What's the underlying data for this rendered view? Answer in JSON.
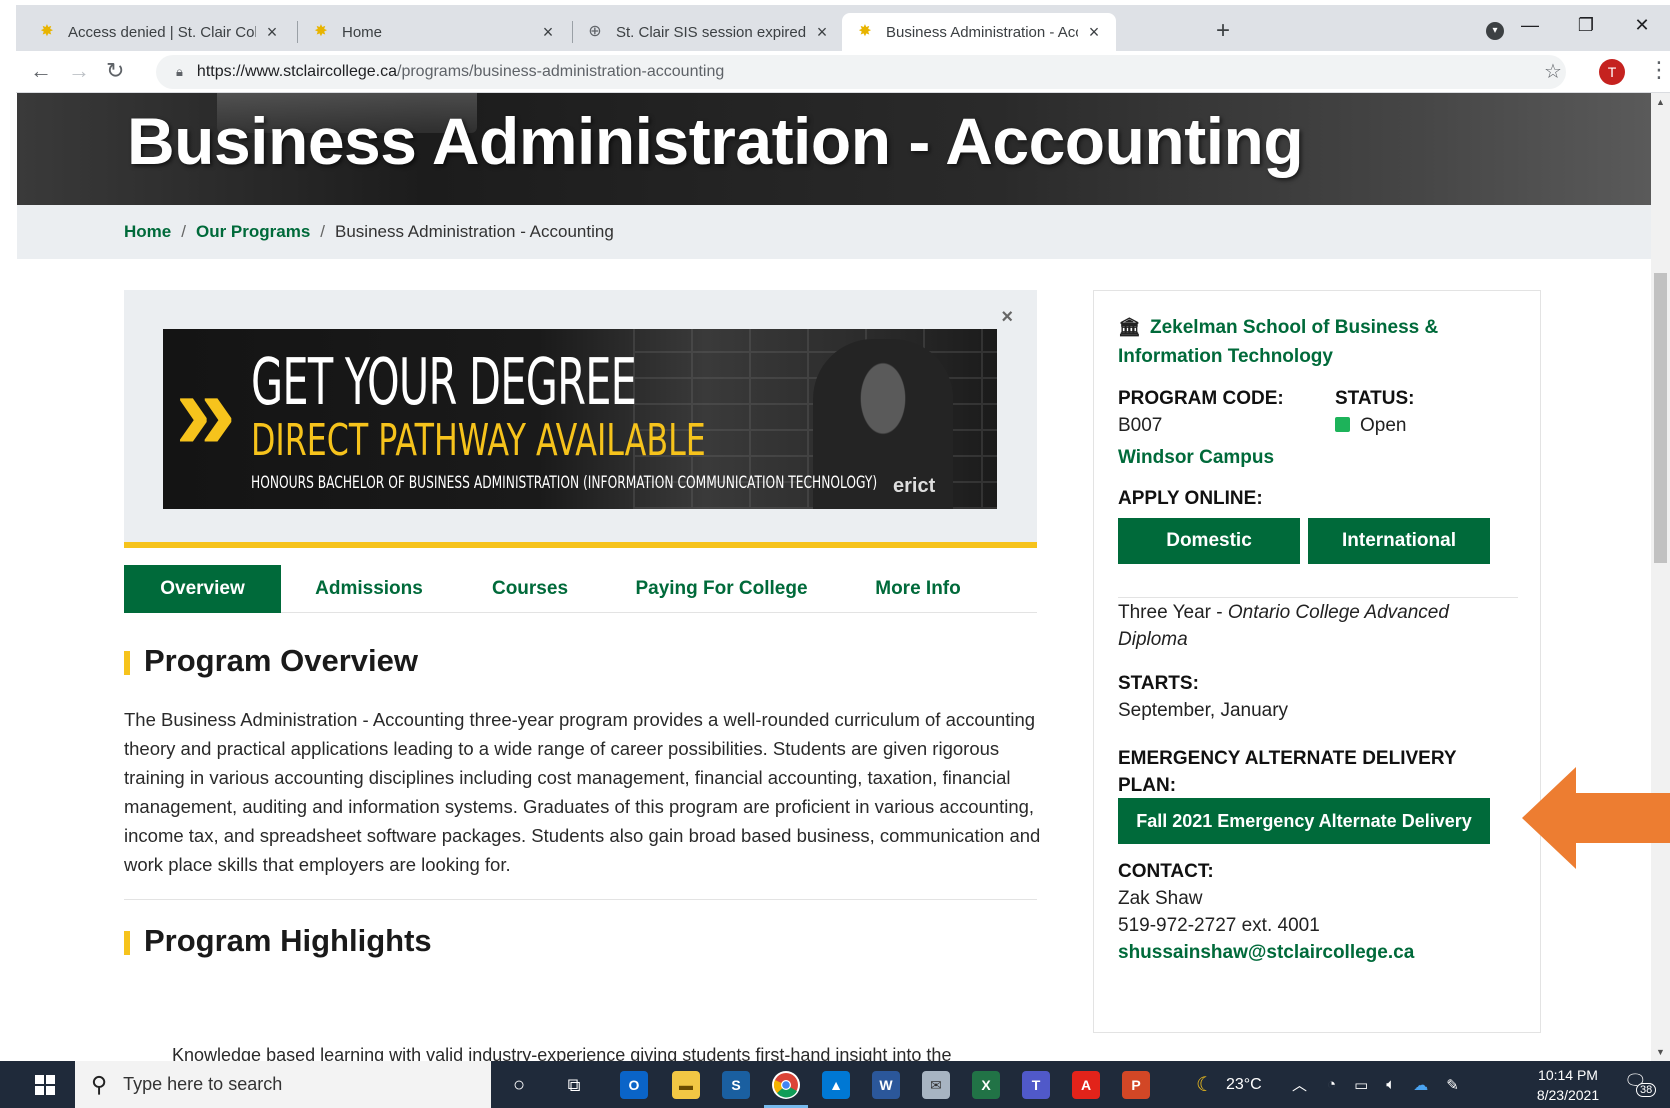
{
  "browser": {
    "tabs": [
      {
        "title": "Access denied | St. Clair College",
        "favicon": "star-icon"
      },
      {
        "title": "Home",
        "favicon": "star-icon"
      },
      {
        "title": "St. Clair SIS session expired",
        "favicon": "globe-icon"
      },
      {
        "title": "Business Administration - Accour",
        "favicon": "star-icon",
        "active": true
      }
    ],
    "url_host": "https://www.stclaircollege.ca",
    "url_path": "/programs/business-administration-accounting",
    "profile_initial": "T"
  },
  "hero": {
    "title": "Business Administration - Accounting"
  },
  "breadcrumb": {
    "home": "Home",
    "programs": "Our Programs",
    "current": "Business Administration - Accounting",
    "separator": "/"
  },
  "promo": {
    "line1": "GET YOUR DEGREE",
    "line2": "DIRECT PATHWAY AVAILABLE",
    "line3": "HONOURS BACHELOR OF BUSINESS ADMINISTRATION (INFORMATION COMMUNICATION TECHNOLOGY)",
    "brand": "erict",
    "close": "×",
    "accent_color": "#f6c31c"
  },
  "page_tabs": [
    "Overview",
    "Admissions",
    "Courses",
    "Paying For College",
    "More Info"
  ],
  "overview": {
    "heading": "Program Overview",
    "text": "The Business Administration - Accounting three-year program provides a well-rounded curriculum of accounting theory and practical applications leading to a wide range of career possibilities. Students are given rigorous training in various accounting disciplines including cost management, financial accounting, taxation, financial management, auditing and information systems. Graduates of this program are proficient in various accounting, income tax, and spreadsheet software packages. Students also gain broad based business, communication and work place skills that employers are looking for."
  },
  "highlights": {
    "heading": "Program Highlights",
    "cutoff_text": "Knowledge based learning with valid industry-experience giving students first-hand insight into the"
  },
  "sidebar": {
    "school": "Zekelman School of Business & Information Technology",
    "program_code_label": "PROGRAM CODE:",
    "program_code": "B007",
    "status_label": "STATUS:",
    "status": "Open",
    "campus": "Windsor Campus",
    "apply_label": "APPLY ONLINE:",
    "apply_domestic": "Domestic",
    "apply_international": "International",
    "credential_prefix": "Three Year - ",
    "credential": "Ontario College Advanced Diploma",
    "starts_label": "STARTS:",
    "starts": "September, January",
    "eadp_label": "EMERGENCY ALTERNATE DELIVERY PLAN:",
    "eadp_button": "Fall 2021 Emergency Alternate Delivery",
    "contact_label": "CONTACT:",
    "contact_name": "Zak Shaw",
    "contact_phone": "519-972-2727 ext. 4001",
    "contact_email": "shussainshaw@stclaircollege.ca"
  },
  "taskbar": {
    "search_placeholder": "Type here to search",
    "weather": "23°C",
    "time": "10:14 PM",
    "date": "8/23/2021",
    "notifications": "38"
  },
  "colors": {
    "brand_green": "#006a3a",
    "accent_yellow": "#f6c31c",
    "annotation_orange": "#ed7d31",
    "status_open": "#1db35a"
  }
}
